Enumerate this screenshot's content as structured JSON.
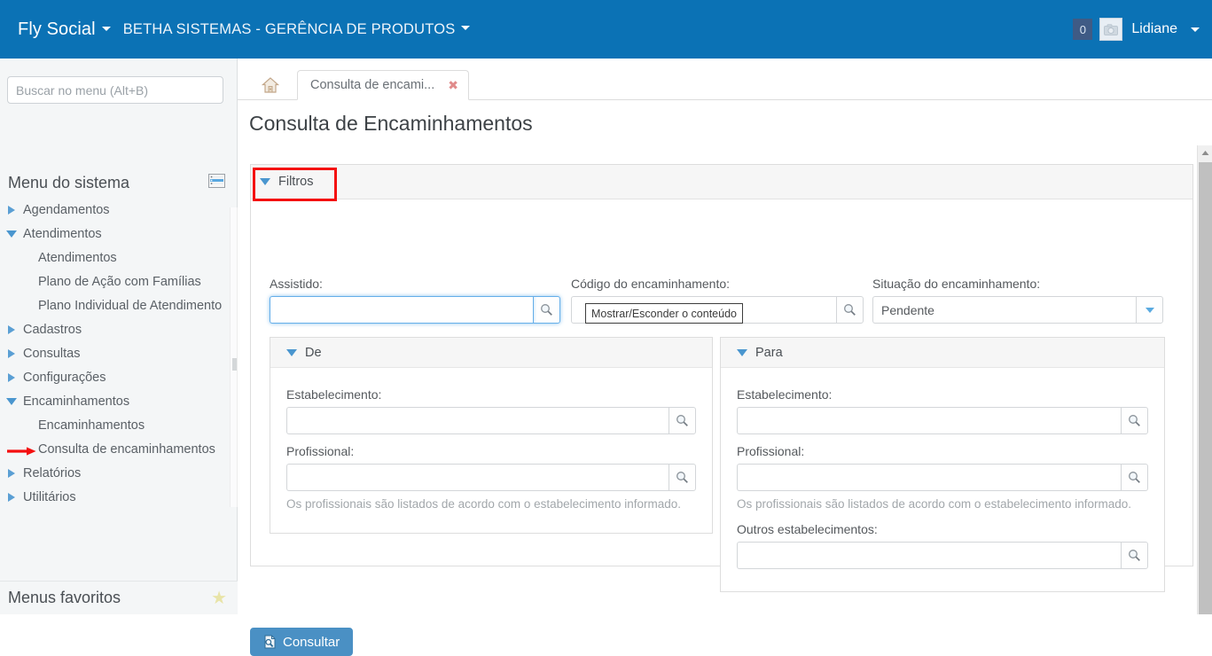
{
  "header": {
    "brand": "Fly Social",
    "org": "BETHA SISTEMAS - GERÊNCIA DE PRODUTOS",
    "notification_count": "0",
    "username": "Lidiane",
    "brand_color": "#0b72b5",
    "badge_color": "#3f5b85"
  },
  "sidebar": {
    "search_placeholder": "Buscar no menu (Alt+B)",
    "search_value": "",
    "menu_title": "Menu do sistema",
    "favorites_title": "Menus favoritos",
    "items": [
      {
        "label": "Agendamentos",
        "level": 0,
        "state": "collapsed"
      },
      {
        "label": "Atendimentos",
        "level": 0,
        "state": "expanded"
      },
      {
        "label": "Atendimentos",
        "level": 1,
        "state": "leaf"
      },
      {
        "label": "Plano de Ação com Famílias",
        "level": 1,
        "state": "leaf"
      },
      {
        "label": "Plano Individual de Atendimento",
        "level": 1,
        "state": "leaf"
      },
      {
        "label": "Cadastros",
        "level": 0,
        "state": "collapsed"
      },
      {
        "label": "Consultas",
        "level": 0,
        "state": "collapsed"
      },
      {
        "label": "Configurações",
        "level": 0,
        "state": "collapsed"
      },
      {
        "label": "Encaminhamentos",
        "level": 0,
        "state": "expanded"
      },
      {
        "label": "Encaminhamentos",
        "level": 1,
        "state": "leaf"
      },
      {
        "label": "Consulta de encaminhamentos",
        "level": 1,
        "state": "leaf",
        "annotated": true
      },
      {
        "label": "Relatórios",
        "level": 0,
        "state": "collapsed"
      },
      {
        "label": "Utilitários",
        "level": 0,
        "state": "collapsed"
      }
    ]
  },
  "tabs": {
    "home_icon": "home-icon",
    "active_label": "Consulta de encami...",
    "close_label": "✖"
  },
  "page": {
    "title": "Consulta de Encaminhamentos"
  },
  "filters": {
    "header_label": "Filtros",
    "annotation_color": "#f40f0f",
    "assistido": {
      "label": "Assistido:",
      "value": "",
      "focused": true
    },
    "codigo": {
      "label": "Código do encaminhamento:",
      "value": ""
    },
    "situacao": {
      "label": "Situação do encaminhamento:",
      "value": "Pendente"
    }
  },
  "de_panel": {
    "header_label": "De",
    "estabelecimento": {
      "label": "Estabelecimento:",
      "value": ""
    },
    "profissional": {
      "label": "Profissional:",
      "value": ""
    },
    "hint": "Os profissionais são listados de acordo com o estabelecimento informado."
  },
  "para_panel": {
    "header_label": "Para",
    "estabelecimento": {
      "label": "Estabelecimento:",
      "value": ""
    },
    "profissional": {
      "label": "Profissional:",
      "value": ""
    },
    "hint": "Os profissionais são listados de acordo com o estabelecimento informado.",
    "outros": {
      "label": "Outros estabelecimentos:",
      "value": ""
    }
  },
  "tooltip": {
    "text": "Mostrar/Esconder o conteúdo"
  },
  "actions": {
    "consultar_label": "Consultar"
  }
}
